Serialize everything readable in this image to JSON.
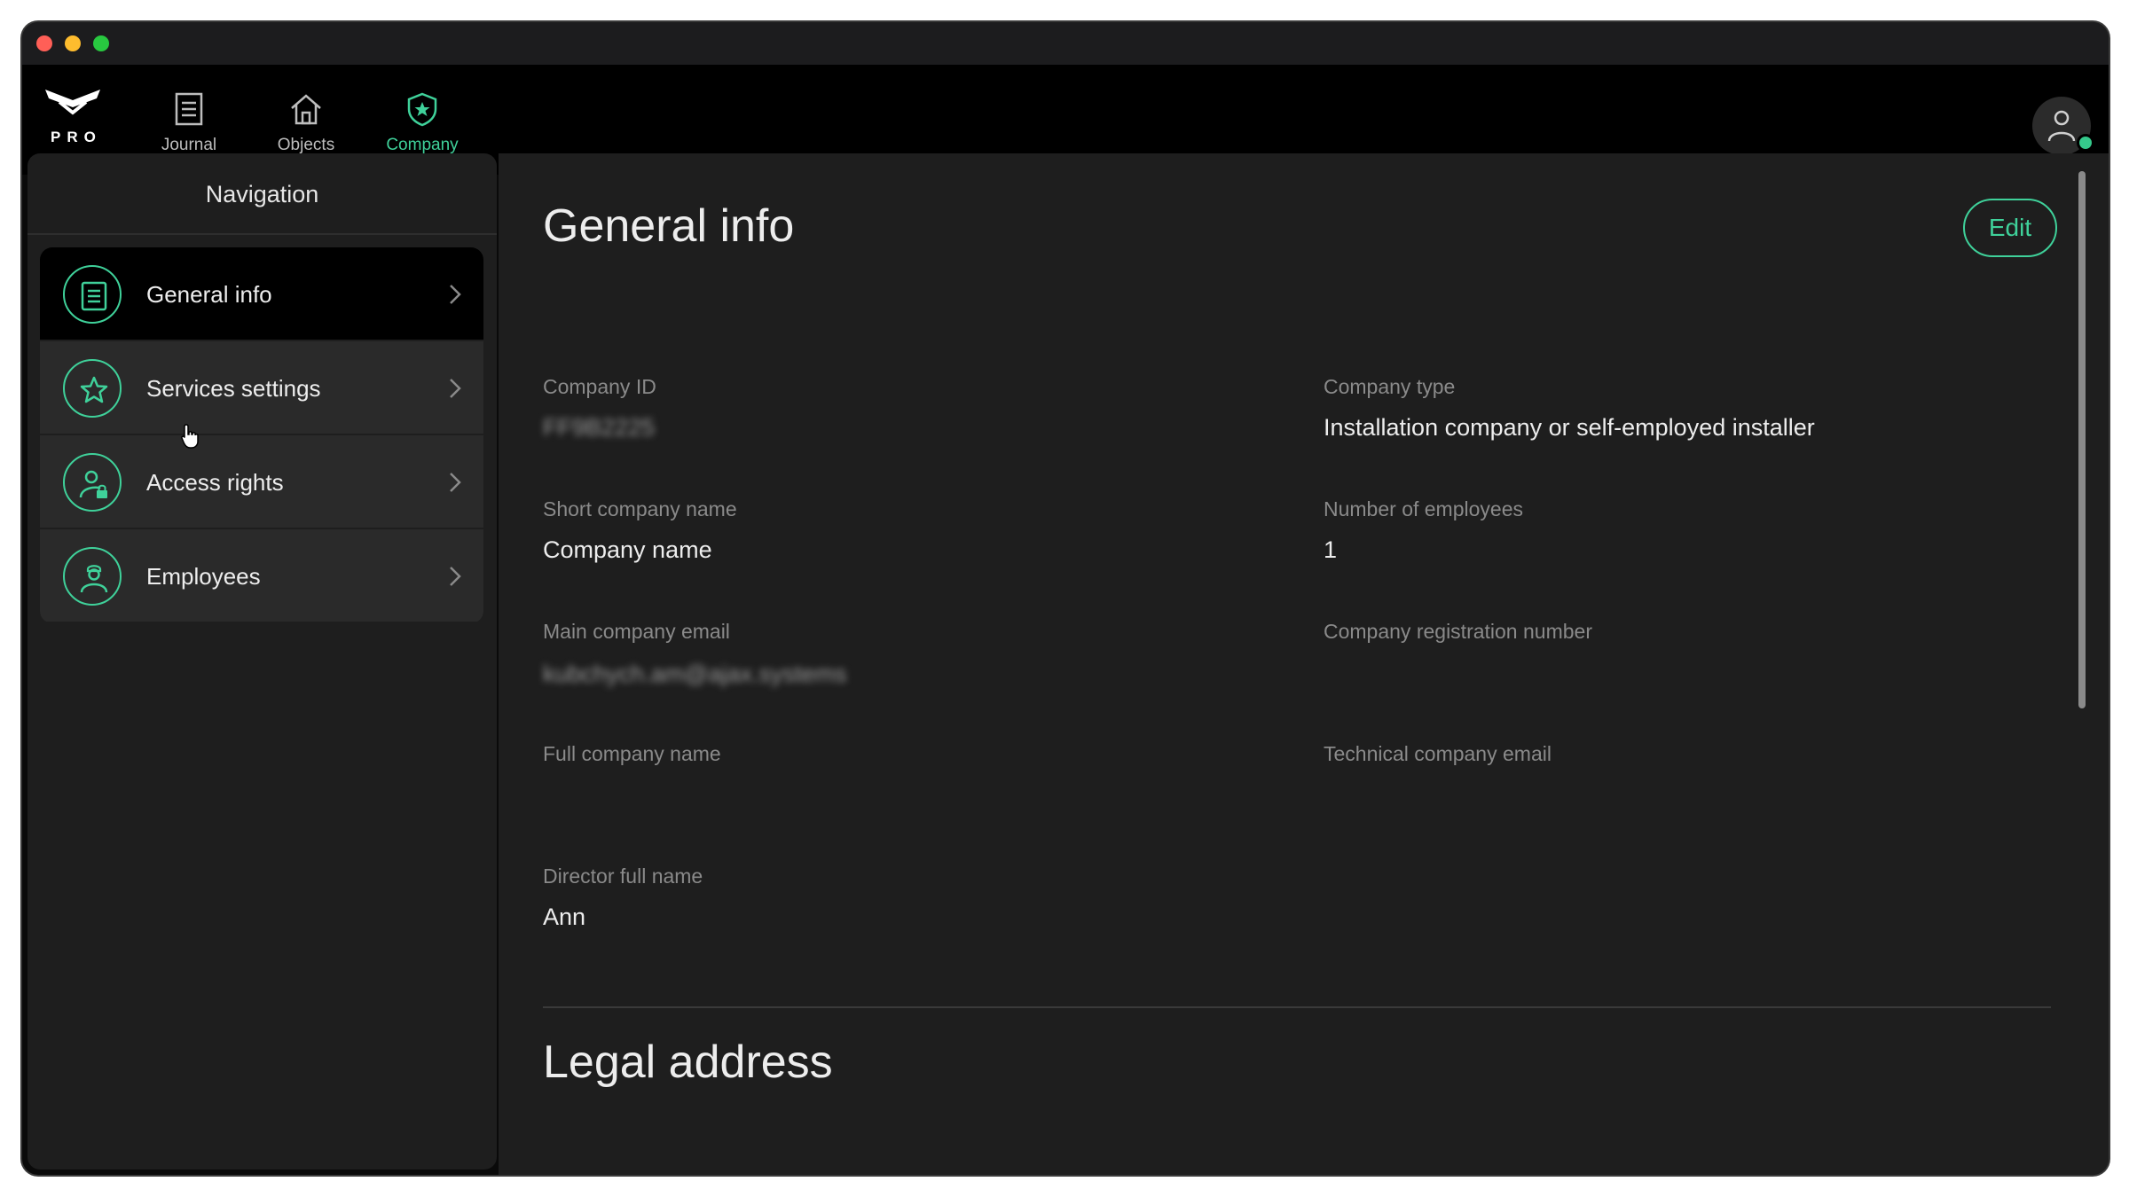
{
  "app": {
    "logo_text": "PRO"
  },
  "topnav": {
    "tabs": [
      {
        "label": "Journal",
        "icon": "journal-icon"
      },
      {
        "label": "Objects",
        "icon": "home-icon"
      },
      {
        "label": "Company",
        "icon": "shield-star-icon",
        "active": true
      }
    ]
  },
  "sidebar": {
    "title": "Navigation",
    "items": [
      {
        "label": "General info",
        "icon": "document-list-icon",
        "active": true
      },
      {
        "label": "Services settings",
        "icon": "star-icon"
      },
      {
        "label": "Access rights",
        "icon": "user-lock-icon"
      },
      {
        "label": "Employees",
        "icon": "employee-icon"
      }
    ]
  },
  "main": {
    "title": "General info",
    "edit_label": "Edit",
    "fields": {
      "company_id": {
        "label": "Company ID",
        "value": "FF9B2225"
      },
      "company_type": {
        "label": "Company type",
        "value": "Installation company or self-employed installer"
      },
      "short_name": {
        "label": "Short company name",
        "value": "Company name"
      },
      "employees": {
        "label": "Number of employees",
        "value": "1"
      },
      "main_email": {
        "label": "Main company email",
        "value": "kubchych.am@ajax.systems"
      },
      "reg_number": {
        "label": "Company registration number",
        "value": ""
      },
      "full_name": {
        "label": "Full company name",
        "value": ""
      },
      "tech_email": {
        "label": "Technical company email",
        "value": ""
      },
      "director": {
        "label": "Director full name",
        "value": "Ann"
      }
    },
    "section_title": "Legal address"
  },
  "colors": {
    "accent": "#3fd19a",
    "background": "#1e1e1e",
    "topbar": "#000000"
  }
}
